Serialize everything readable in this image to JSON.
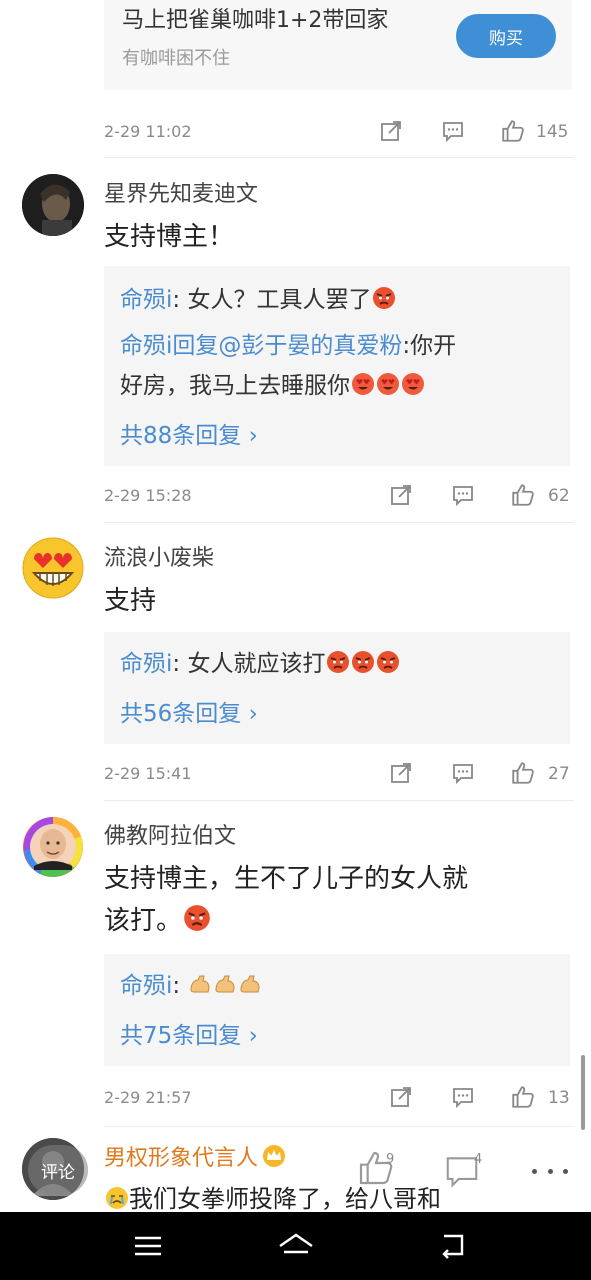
{
  "promo": {
    "title": "马上把雀巢咖啡1+2带回家",
    "subtitle": "有咖啡困不住",
    "buy_label": "购买"
  },
  "top_meta": {
    "time": "2-29 11:02",
    "likes": "145"
  },
  "comments": [
    {
      "user": "星界先知麦迪文",
      "text": "支持博主！",
      "replies": [
        {
          "who": "命殒i",
          "sep": ": ",
          "text": "女人？工具人罢了",
          "emoji": [
            "angry"
          ]
        },
        {
          "who": "命殒i",
          "sep": "回复",
          "mention": "@彭于晏的真爱粉",
          "text": ":你开",
          "text2": "好房，我马上去睡服你",
          "emoji": [
            "love",
            "love",
            "love"
          ]
        }
      ],
      "more": "共88条回复 ›",
      "time": "2-29 15:28",
      "likes": "62"
    },
    {
      "user": "流浪小废柴",
      "text": "支持",
      "replies": [
        {
          "who": "命殒i",
          "sep": ": ",
          "text": "女人就应该打",
          "emoji": [
            "angry",
            "angry",
            "angry"
          ]
        }
      ],
      "more": "共56条回复 ›",
      "time": "2-29 15:41",
      "likes": "27"
    },
    {
      "user": "佛教阿拉伯文",
      "text_line1": "支持博主，生不了儿子的女人就",
      "text_line2": "该打。",
      "replies": [
        {
          "who": "命殒i",
          "sep": ": ",
          "text": "",
          "emoji": [
            "muscle",
            "muscle",
            "muscle"
          ]
        }
      ],
      "more": "共75条回复 ›",
      "time": "2-29 21:57",
      "likes": "13"
    },
    {
      "user": "男权形象代言人",
      "text": "我们女拳师投降了，给八哥和"
    }
  ],
  "bottom_bar": {
    "comment_label": "评论",
    "like_count": "9",
    "comment_count": "4"
  },
  "colors": {
    "link_blue": "#4a8ccf",
    "buy_button": "#3f8fd6",
    "meta_gray": "#8a8a8a",
    "reply_bg": "#f5f5f5"
  },
  "icons": {
    "share": "share-icon",
    "comment": "comment-icon",
    "like": "like-icon",
    "more": "more-icon",
    "nav_menu": "menu-icon",
    "nav_home": "home-icon",
    "nav_back": "back-icon"
  }
}
